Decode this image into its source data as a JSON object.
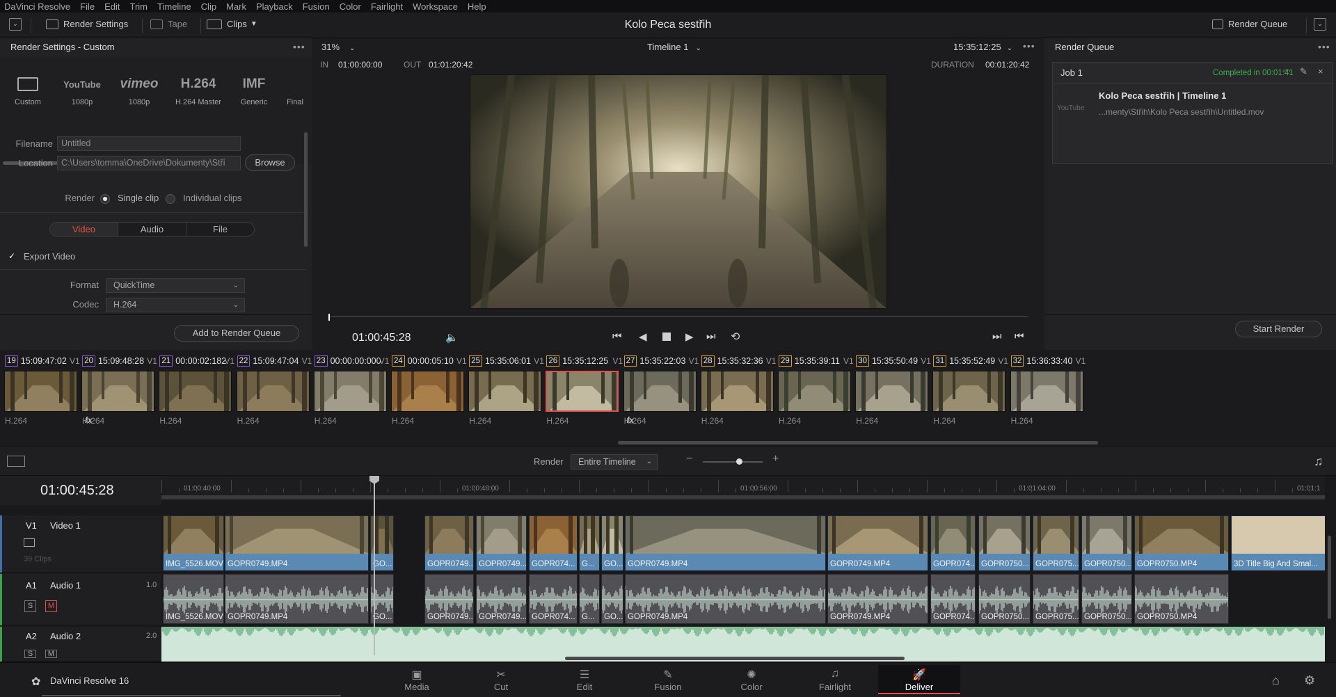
{
  "menu": [
    "DaVinci Resolve",
    "File",
    "Edit",
    "Trim",
    "Timeline",
    "Clip",
    "Mark",
    "Playback",
    "Fusion",
    "Color",
    "Fairlight",
    "Workspace",
    "Help"
  ],
  "toolbar": {
    "render_settings": "Render Settings",
    "tape": "Tape",
    "clips": "Clips",
    "render_queue": "Render Queue"
  },
  "project_title": "Kolo Peca sestřih",
  "render_settings": {
    "header": "Render Settings - Custom",
    "presets": [
      {
        "logo": "",
        "label": "Custom"
      },
      {
        "logo": "YouTube",
        "label": "1080p"
      },
      {
        "logo": "vimeo",
        "label": "1080p"
      },
      {
        "logo": "H.264",
        "label": "H.264 Master"
      },
      {
        "logo": "IMF",
        "label": "Generic"
      },
      {
        "logo": "",
        "label": "Final"
      }
    ],
    "filename_label": "Filename",
    "filename_value": "Untitled",
    "location_label": "Location",
    "location_value": "C:\\Users\\tomma\\OneDrive\\Dokumenty\\Stři",
    "browse": "Browse",
    "render_label": "Render",
    "single_clip": "Single clip",
    "individual_clips": "Individual clips",
    "tabs": {
      "video": "Video",
      "audio": "Audio",
      "file": "File"
    },
    "export_video": "Export Video",
    "format_label": "Format",
    "format_value": "QuickTime",
    "codec_label": "Codec",
    "codec_value": "H.264",
    "add_to_queue": "Add to Render Queue"
  },
  "viewer": {
    "zoom": "31%",
    "timeline_name": "Timeline 1",
    "timecode_top": "15:35:12:25",
    "in_label": "IN",
    "in_value": "01:00:00:00",
    "out_label": "OUT",
    "out_value": "01:01:20:42",
    "duration_label": "DURATION",
    "duration_value": "00:01:20:42",
    "current_tc": "01:00:45:28"
  },
  "render_queue": {
    "header": "Render Queue",
    "job": "Job 1",
    "status": "Completed in 00:01:41",
    "job_title": "Kolo Peca sestřih | Timeline 1",
    "job_logo": "YouTube",
    "job_path": "...menty\\Střih\\Kolo Peca sestřih\\Untitled.mov",
    "start_render": "Start Render"
  },
  "clips": [
    {
      "num": "19",
      "tc": "15:09:47:02",
      "track": "V1",
      "codec": "H.264",
      "fx": true,
      "color": "#8a5cd0"
    },
    {
      "num": "20",
      "tc": "15:09:48:28",
      "track": "V1",
      "codec": "H.264",
      "fx": false,
      "color": "#8a5cd0"
    },
    {
      "num": "21",
      "tc": "00:00:02:182",
      "track": "V1",
      "codec": "H.264",
      "fx": false,
      "color": "#8a5cd0"
    },
    {
      "num": "22",
      "tc": "15:09:47:04",
      "track": "V1",
      "codec": "H.264",
      "fx": false,
      "color": "#8a5cd0"
    },
    {
      "num": "23",
      "tc": "00:00:00:000",
      "track": "V1",
      "codec": "H.264",
      "fx": false,
      "color": "#8a5cd0"
    },
    {
      "num": "24",
      "tc": "00:00:05:10",
      "track": "V1",
      "codec": "H.264",
      "fx": false,
      "color": "#d8a030"
    },
    {
      "num": "25",
      "tc": "15:35:06:01",
      "track": "V1",
      "codec": "H.264",
      "fx": false,
      "color": "#d8a030"
    },
    {
      "num": "26",
      "tc": "15:35:12:25",
      "track": "V1",
      "codec": "H.264",
      "fx": true,
      "color": "#d8a030"
    },
    {
      "num": "27",
      "tc": "15:35:22:03",
      "track": "V1",
      "codec": "H.264",
      "fx": false,
      "color": "#d8a030"
    },
    {
      "num": "28",
      "tc": "15:35:32:36",
      "track": "V1",
      "codec": "H.264",
      "fx": false,
      "color": "#d8a030"
    },
    {
      "num": "29",
      "tc": "15:35:39:11",
      "track": "V1",
      "codec": "H.264",
      "fx": false,
      "color": "#d8a030"
    },
    {
      "num": "30",
      "tc": "15:35:50:49",
      "track": "V1",
      "codec": "H.264",
      "fx": false,
      "color": "#d8a030"
    },
    {
      "num": "31",
      "tc": "15:35:52:49",
      "track": "V1",
      "codec": "H.264",
      "fx": false,
      "color": "#d8a030"
    },
    {
      "num": "32",
      "tc": "15:36:33:40",
      "track": "V1",
      "codec": "H.264",
      "fx": false,
      "color": "#d8a030"
    }
  ],
  "timeline": {
    "render_label": "Render",
    "render_value": "Entire Timeline",
    "current_tc": "01:00:45:28",
    "ruler": [
      "01:00:40:00",
      "01:00:48:00",
      "01:00:56:00",
      "01:01:04:00",
      "01:01:1"
    ],
    "tracks": [
      {
        "id": "V1",
        "name": "Video 1",
        "info": "39 Clips"
      },
      {
        "id": "A1",
        "name": "Audio 1",
        "level": "1.0"
      },
      {
        "id": "A2",
        "name": "Audio 2",
        "level": "2.0"
      }
    ],
    "video_clips": [
      "IMG_5526.MOV",
      "GOPR0749.MP4",
      "GO...",
      "GOPR0749...",
      "GOPR0749...",
      "GOPR074...",
      "G...",
      "GO...",
      "GOPR0749.MP4",
      "GOPR0749.MP4",
      "GOPR074...",
      "GOPR0750...",
      "GOPR075...",
      "GOPR0750...",
      "GOPR0750.MP4",
      "3D Title Big And Smal..."
    ],
    "audio_clips": [
      "IMG_5526.MOV",
      "GOPR0749.MP4",
      "GO...",
      "GOPR0749...",
      "GOPR0749...",
      "GOPR074...",
      "G...",
      "GO...",
      "GOPR0749.MP4",
      "GOPR0749.MP4",
      "GOPR074...",
      "GOPR0750...",
      "GOPR075...",
      "GOPR0750...",
      "GOPR0750.MP4"
    ]
  },
  "bottom": {
    "app": "DaVinci Resolve 16",
    "pages": [
      {
        "label": "Media",
        "icon": "media-icon",
        "glyph": "▣"
      },
      {
        "label": "Cut",
        "icon": "cut-icon",
        "glyph": "✂"
      },
      {
        "label": "Edit",
        "icon": "edit-icon",
        "glyph": "☰"
      },
      {
        "label": "Fusion",
        "icon": "fusion-icon",
        "glyph": "✎"
      },
      {
        "label": "Color",
        "icon": "color-icon",
        "glyph": "✺"
      },
      {
        "label": "Fairlight",
        "icon": "fairlight-icon",
        "glyph": "♫"
      },
      {
        "label": "Deliver",
        "icon": "deliver-icon",
        "glyph": "🚀"
      }
    ]
  }
}
